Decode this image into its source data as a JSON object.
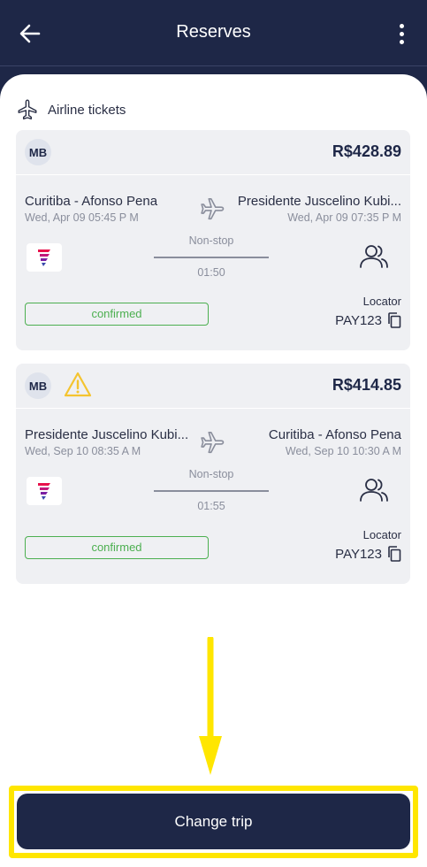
{
  "header": {
    "title": "Reserves",
    "back_icon": "arrow-left-icon",
    "menu_icon": "more-vertical-icon"
  },
  "section": {
    "label": "Airline tickets",
    "icon": "airplane-icon"
  },
  "reservations": [
    {
      "badge": "MB",
      "warning": false,
      "price": "R$428.89",
      "origin": "Curitiba - Afonso Pena",
      "origin_datetime": "Wed, Apr 09 05:45 P M",
      "destination": "Presidente Juscelino Kubi...",
      "destination_datetime": "Wed, Apr 09 07:35 P M",
      "stops": "Non-stop",
      "duration": "01:50",
      "status": "confirmed",
      "locator_label": "Locator",
      "locator": "PAY123"
    },
    {
      "badge": "MB",
      "warning": true,
      "price": "R$414.85",
      "origin": "Presidente Juscelino Kubi...",
      "origin_datetime": "Wed, Sep 10 08:35 A M",
      "destination": "Curitiba - Afonso Pena",
      "destination_datetime": "Wed, Sep 10 10:30 A M",
      "stops": "Non-stop",
      "duration": "01:55",
      "status": "confirmed",
      "locator_label": "Locator",
      "locator": "PAY123"
    }
  ],
  "cta": {
    "label": "Change trip"
  },
  "colors": {
    "navy": "#1e2747",
    "confirmed": "#4caf50",
    "highlight": "#ffe600",
    "warning": "#f4c430"
  }
}
